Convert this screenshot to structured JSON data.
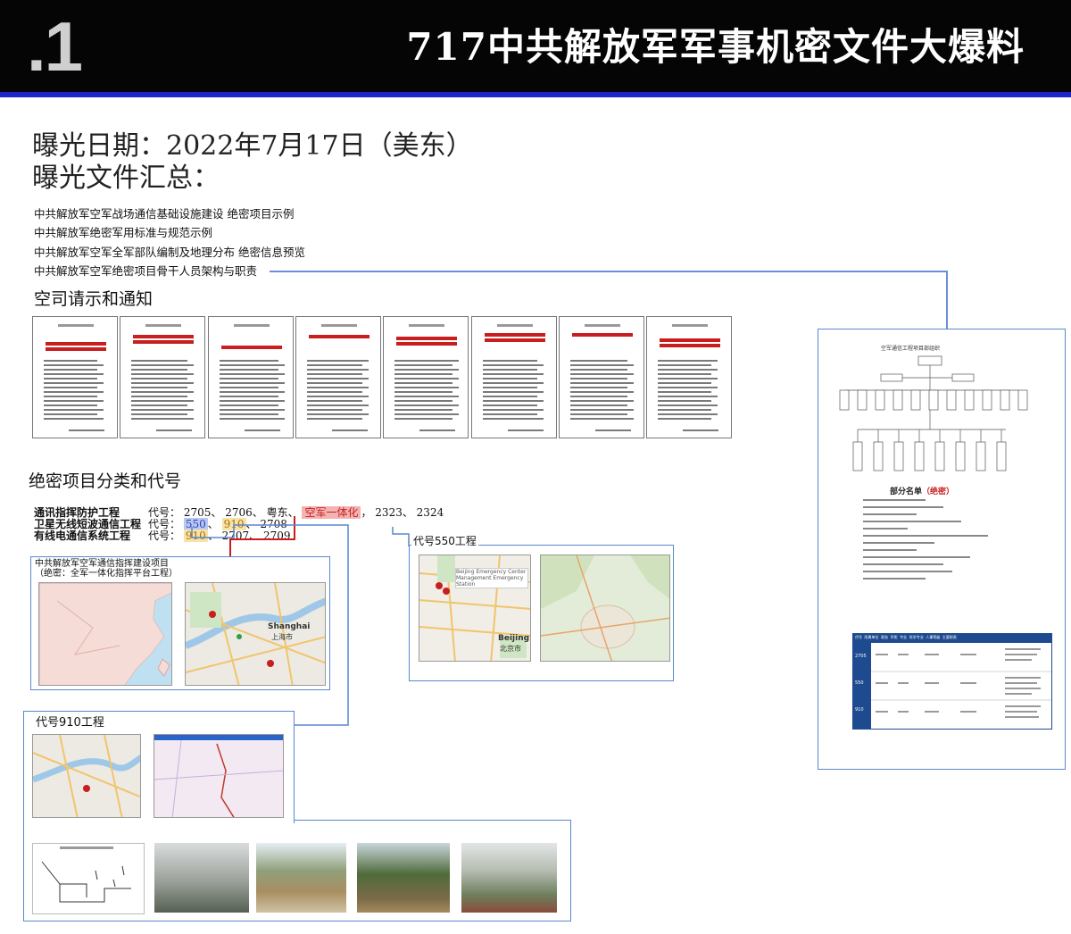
{
  "header": {
    "slide_number": ".1",
    "title": "717中共解放军军事机密文件大爆料"
  },
  "exposure": {
    "date_line": "曝光日期：2022年7月17日（美东）",
    "summary_heading": "曝光文件汇总："
  },
  "file_list": [
    "中共解放军空军战场通信基础设施建设 绝密项目示例",
    "中共解放军绝密军用标准与规范示例",
    "中共解放军空军全军部队编制及地理分布 绝密信息预览",
    "中共解放军空军绝密项目骨干人员架构与职责"
  ],
  "section_requests": "空司请示和通知",
  "section_projects": "绝密项目分类和代号",
  "projects": [
    {
      "name": "通讯指挥防护工程",
      "code_label": "代号：",
      "codes": [
        "2705、",
        "2706、",
        "粤东、",
        "空军一体化",
        "，",
        "2323、",
        "2324"
      ],
      "highlight": {
        "3": "red"
      }
    },
    {
      "name": "卫星无线短波通信工程",
      "code_label": "代号：",
      "codes": [
        "550",
        "、",
        "910",
        "、",
        "2708"
      ],
      "highlight": {
        "0": "blue",
        "2": "yellow"
      }
    },
    {
      "name": "有线电通信系统工程",
      "code_label": "代号：",
      "codes": [
        "910",
        "、",
        "2707、",
        "2709"
      ],
      "highlight": {
        "0": "yellow"
      }
    }
  ],
  "map_panel_main": {
    "title_line1": "中共解放军空军通信指挥建设项目",
    "title_line2": "（绝密：全军一体化指挥平台工程）",
    "label_shanghai": "Shanghai",
    "label_shanghai_cn": "上海市"
  },
  "panel_550": {
    "caption": "代号550工程",
    "marker_text": "Beijing Emergency Center Management Emergency Station",
    "label_beijing": "Beijing",
    "label_beijing_cn": "北京市"
  },
  "panel_910": {
    "caption": "代号910工程"
  },
  "org_panel": {
    "chart_title": "空军通信工程项目部组织",
    "list_title": "部分名单",
    "list_tag": "（绝密）",
    "table_headers": [
      "代号",
      "所属单位",
      "职务",
      "军衔",
      "专业",
      "所学专业",
      "人事等级",
      "主要职责"
    ],
    "table_rows": [
      "2705",
      "550",
      "910"
    ]
  },
  "colors": {
    "header_bg": "#050505",
    "header_rule": "#1d24c9",
    "accent_blue": "#5a86cf",
    "accent_red": "#c81e1e",
    "table_header": "#1e4b8f"
  }
}
